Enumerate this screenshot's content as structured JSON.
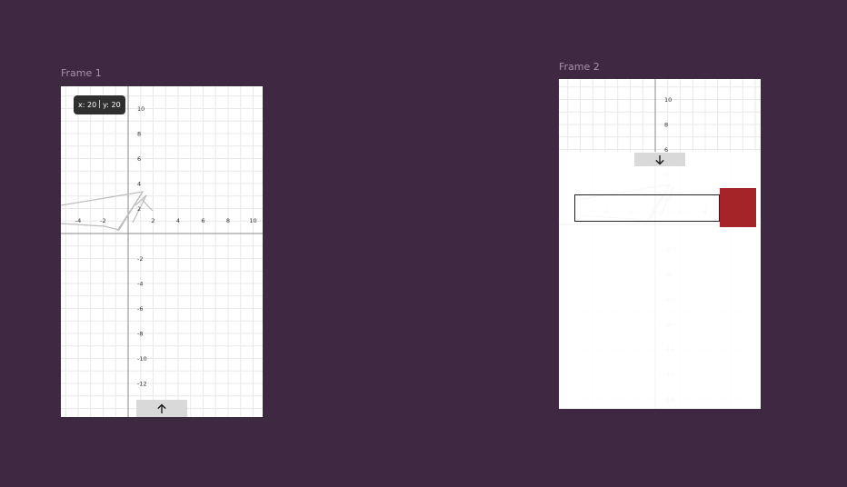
{
  "canvas": {
    "background": "#3f2842"
  },
  "frames": [
    {
      "label": "Frame 1",
      "tooltip": {
        "x_text": "x: 20",
        "y_text": "y: 20"
      },
      "x_ticks": [
        "-4",
        "-2",
        "2",
        "4",
        "6",
        "8",
        "10"
      ],
      "y_ticks": [
        "10",
        "8",
        "6",
        "4",
        "2",
        "-2",
        "-4",
        "-6",
        "-8",
        "-10",
        "-12"
      ],
      "nav_button": {
        "icon": "arrow-up-icon",
        "glyph": "↑"
      }
    },
    {
      "label": "Frame 2",
      "x_ticks": [
        "-4",
        "-2",
        "2",
        "4"
      ],
      "y_ticks": [
        "10",
        "8",
        "6",
        "4",
        "2",
        "-2",
        "-4",
        "-6",
        "-8",
        "-10",
        "-12",
        "-14"
      ],
      "nav_button": {
        "icon": "arrow-down-icon",
        "glyph": "↓"
      },
      "red_block_color": "#a52428"
    }
  ]
}
